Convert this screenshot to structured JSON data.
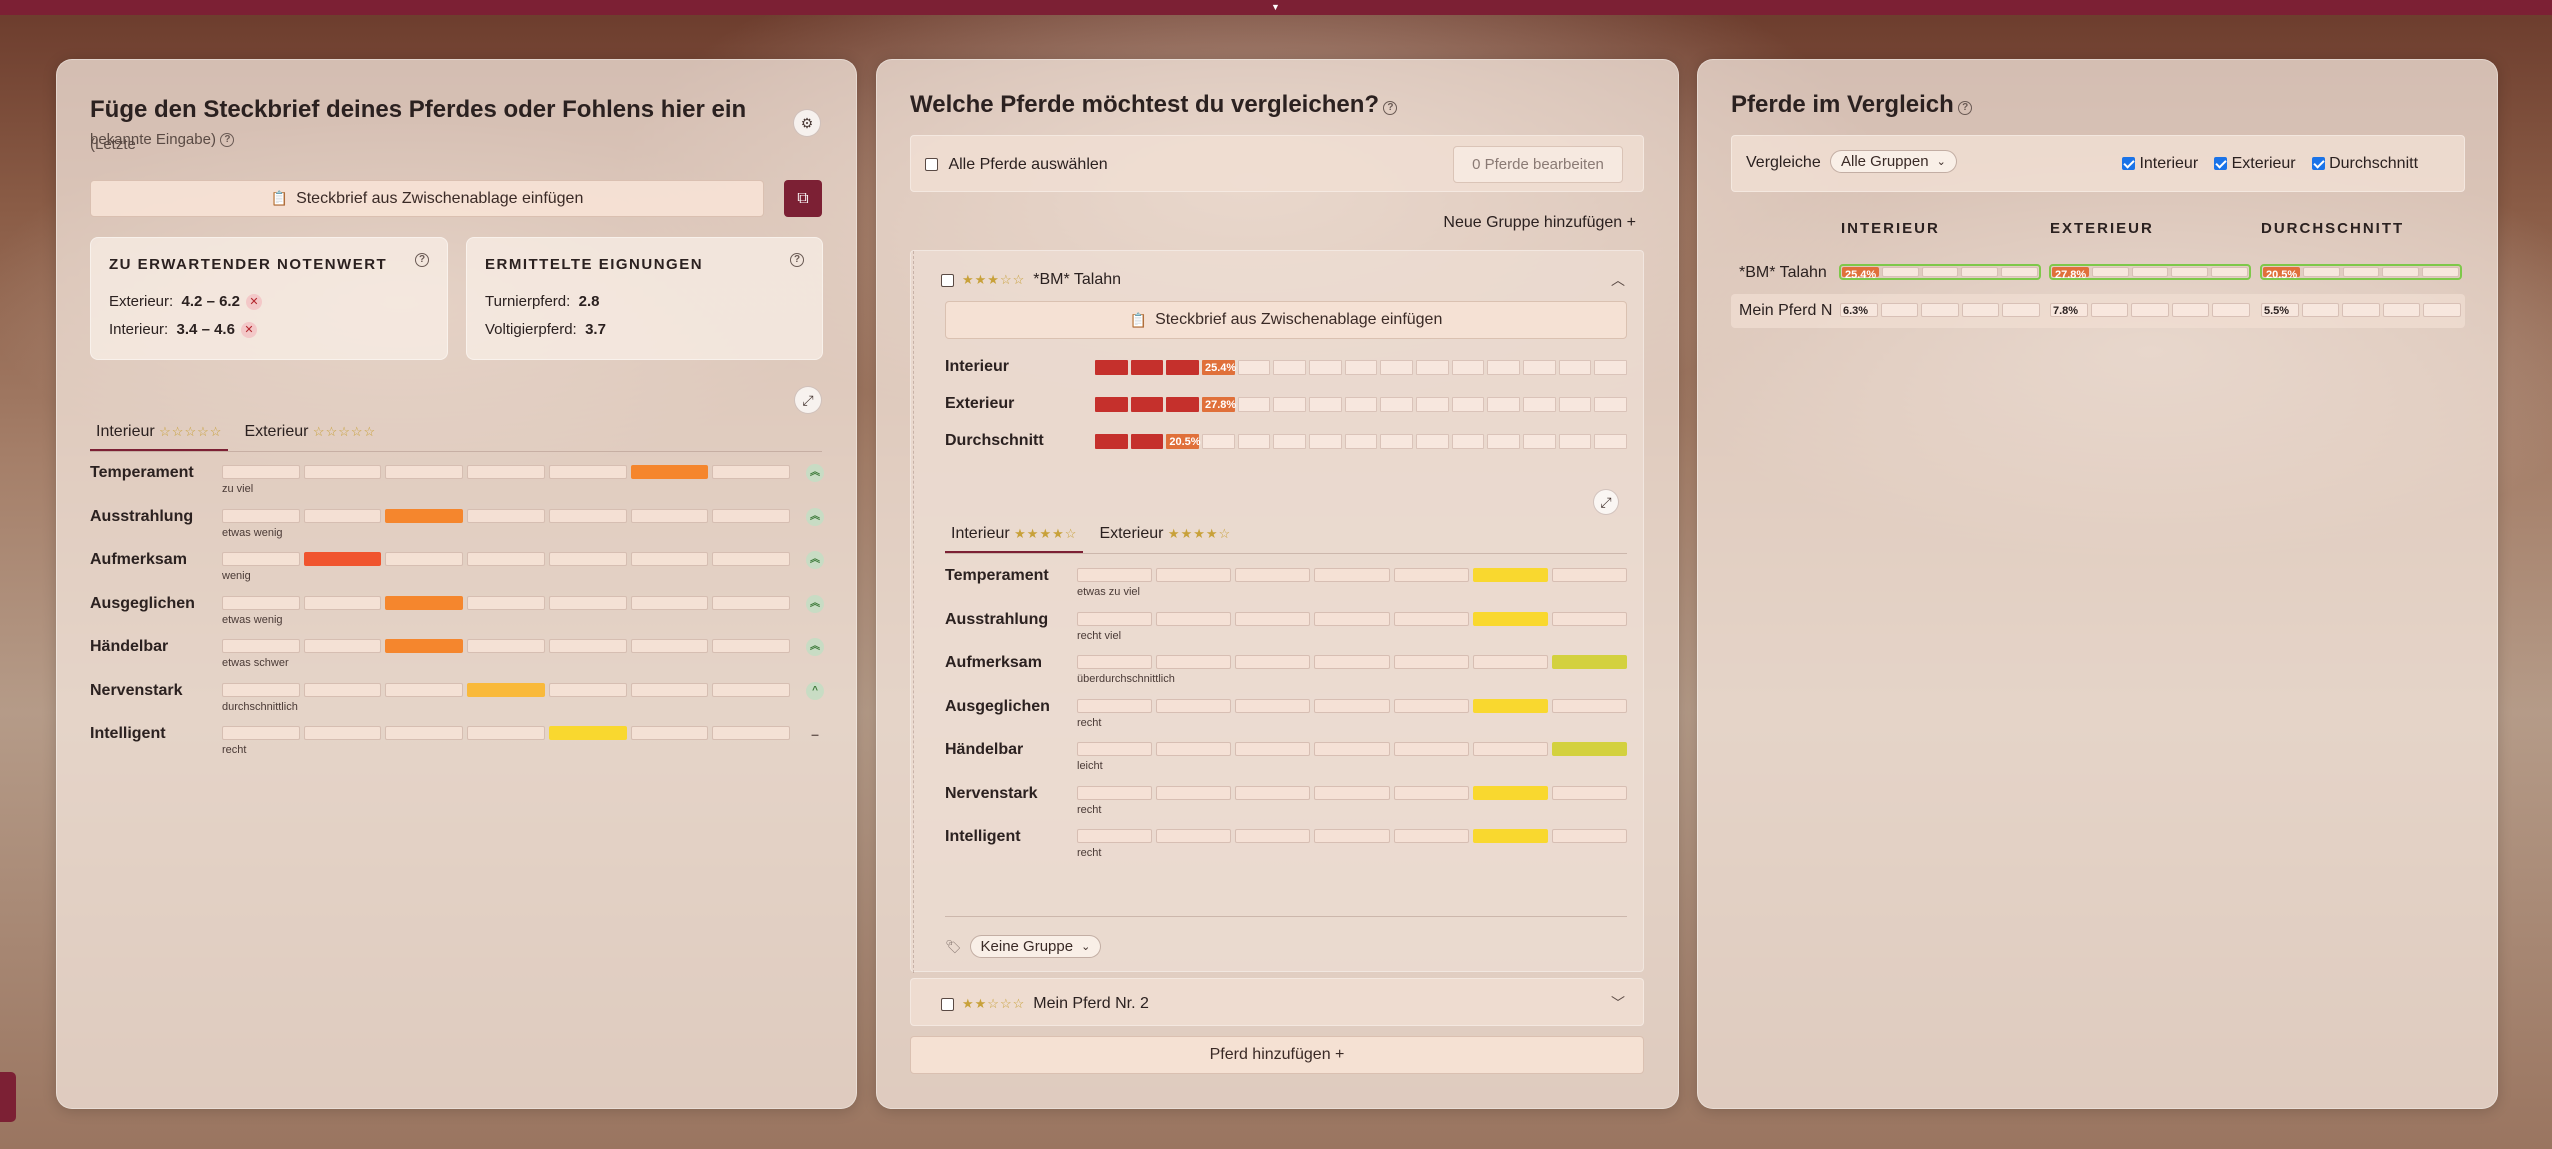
{
  "colors": {
    "brand": "#7c2034",
    "redDark": "#c5302c",
    "redOrange": "#f0542e",
    "orange": "#f5862d",
    "amber": "#f9b93a",
    "yellow": "#f9d82f",
    "olive": "#d3d13e",
    "greenBorder": "#7ec84a"
  },
  "icons": {
    "settings": "gear-icon",
    "help": "question-circle-icon",
    "clipboard": "clipboard-icon",
    "copy": "copy-icon",
    "expand": "expand-icon",
    "collapseUp": "chevron-up-icon",
    "expandDown": "chevron-down-icon",
    "tag": "tag-icon"
  },
  "left": {
    "title": "Füge den Steckbrief deines Pferdes oder Fohlens hier ein",
    "title_suffix": "(Letzte",
    "title_line2": "bekannte Eingabe)",
    "paste_button": "Steckbrief aus Zwischenablage einfügen",
    "card1": {
      "header": "ZU ERWARTENDER NOTENWERT",
      "rows": [
        {
          "label": "Exterieur:",
          "value": "4.2 – 6.2"
        },
        {
          "label": "Interieur:",
          "value": "3.4 – 4.6"
        }
      ]
    },
    "card2": {
      "header": "ERMITTELTE EIGNUNGEN",
      "rows": [
        {
          "label": "Turnierpferd:",
          "value": "2.8"
        },
        {
          "label": "Voltigierpferd:",
          "value": "3.7"
        }
      ]
    },
    "tabs": [
      {
        "label": "Interieur",
        "stars": "☆☆☆☆☆"
      },
      {
        "label": "Exterieur",
        "stars": "☆☆☆☆☆"
      }
    ],
    "traits": [
      {
        "label": "Temperament",
        "sub": "zu viel",
        "segments": 7,
        "filled": 6,
        "color": "#f5862d",
        "indicator": "︽"
      },
      {
        "label": "Ausstrahlung",
        "sub": "etwas wenig",
        "segments": 7,
        "filled": 3,
        "color": "#f5862d",
        "indicator": "︽"
      },
      {
        "label": "Aufmerksam",
        "sub": "wenig",
        "segments": 7,
        "filled": 2,
        "color": "#f0542e",
        "indicator": "︽"
      },
      {
        "label": "Ausgeglichen",
        "sub": "etwas wenig",
        "segments": 7,
        "filled": 3,
        "color": "#f5862d",
        "indicator": "︽"
      },
      {
        "label": "Händelbar",
        "sub": "etwas schwer",
        "segments": 7,
        "filled": 3,
        "color": "#f5862d",
        "indicator": "︽"
      },
      {
        "label": "Nervenstark",
        "sub": "durchschnittlich",
        "segments": 7,
        "filled": 4,
        "color": "#f9b93a",
        "indicator": "^"
      },
      {
        "label": "Intelligent",
        "sub": "recht",
        "segments": 7,
        "filled": 5,
        "color": "#f9d82f",
        "indicator": "–"
      }
    ]
  },
  "middle": {
    "title": "Welche Pferde möchtest du vergleichen?",
    "select_all": "Alle Pferde auswählen",
    "edit_button": "0 Pferde bearbeiten",
    "new_group": "Neue Gruppe hinzufügen  +",
    "horse1": {
      "name": "*BM* Talahn",
      "stars": "★★★☆☆",
      "paste_button": "Steckbrief aus Zwischenablage einfügen",
      "summary": [
        {
          "label": "Interieur",
          "pct": "25.4%"
        },
        {
          "label": "Exterieur",
          "pct": "27.8%"
        },
        {
          "label": "Durchschnitt",
          "pct": "20.5%"
        }
      ],
      "tabs": [
        {
          "label": "Interieur",
          "stars": "★★★★☆"
        },
        {
          "label": "Exterieur",
          "stars": "★★★★☆"
        }
      ],
      "traits": [
        {
          "label": "Temperament",
          "sub": "etwas zu viel",
          "filled": 6,
          "color": "#f9d82f"
        },
        {
          "label": "Ausstrahlung",
          "sub": "recht viel",
          "filled": 6,
          "color": "#f9d82f"
        },
        {
          "label": "Aufmerksam",
          "sub": "überdurchschnittlich",
          "filled": 7,
          "color": "#d3d13e"
        },
        {
          "label": "Ausgeglichen",
          "sub": "recht",
          "filled": 6,
          "color": "#f9d82f"
        },
        {
          "label": "Händelbar",
          "sub": "leicht",
          "filled": 7,
          "color": "#d3d13e"
        },
        {
          "label": "Nervenstark",
          "sub": "recht",
          "filled": 6,
          "color": "#f9d82f"
        },
        {
          "label": "Intelligent",
          "sub": "recht",
          "filled": 6,
          "color": "#f9d82f"
        }
      ],
      "group_select": "Keine Gruppe"
    },
    "horse2": {
      "name": "Mein Pferd Nr. 2",
      "stars": "★★☆☆☆"
    },
    "add_horse": "Pferd hinzufügen  +"
  },
  "right": {
    "title": "Pferde im Vergleich",
    "compare_label": "Vergleiche",
    "group_select": "Alle Gruppen",
    "checks": [
      {
        "label": "Interieur",
        "checked": true
      },
      {
        "label": "Exterieur",
        "checked": true
      },
      {
        "label": "Durchschnitt",
        "checked": true
      }
    ],
    "columns": [
      "INTERIEUR",
      "EXTERIEUR",
      "DURCHSCHNITT"
    ],
    "rows": [
      {
        "name": "*BM* Talahn",
        "values": [
          "25.4%",
          "27.8%",
          "20.5%"
        ]
      },
      {
        "name": "Mein Pferd N",
        "values": [
          "6.3%",
          "7.8%",
          "5.5%"
        ]
      }
    ]
  }
}
